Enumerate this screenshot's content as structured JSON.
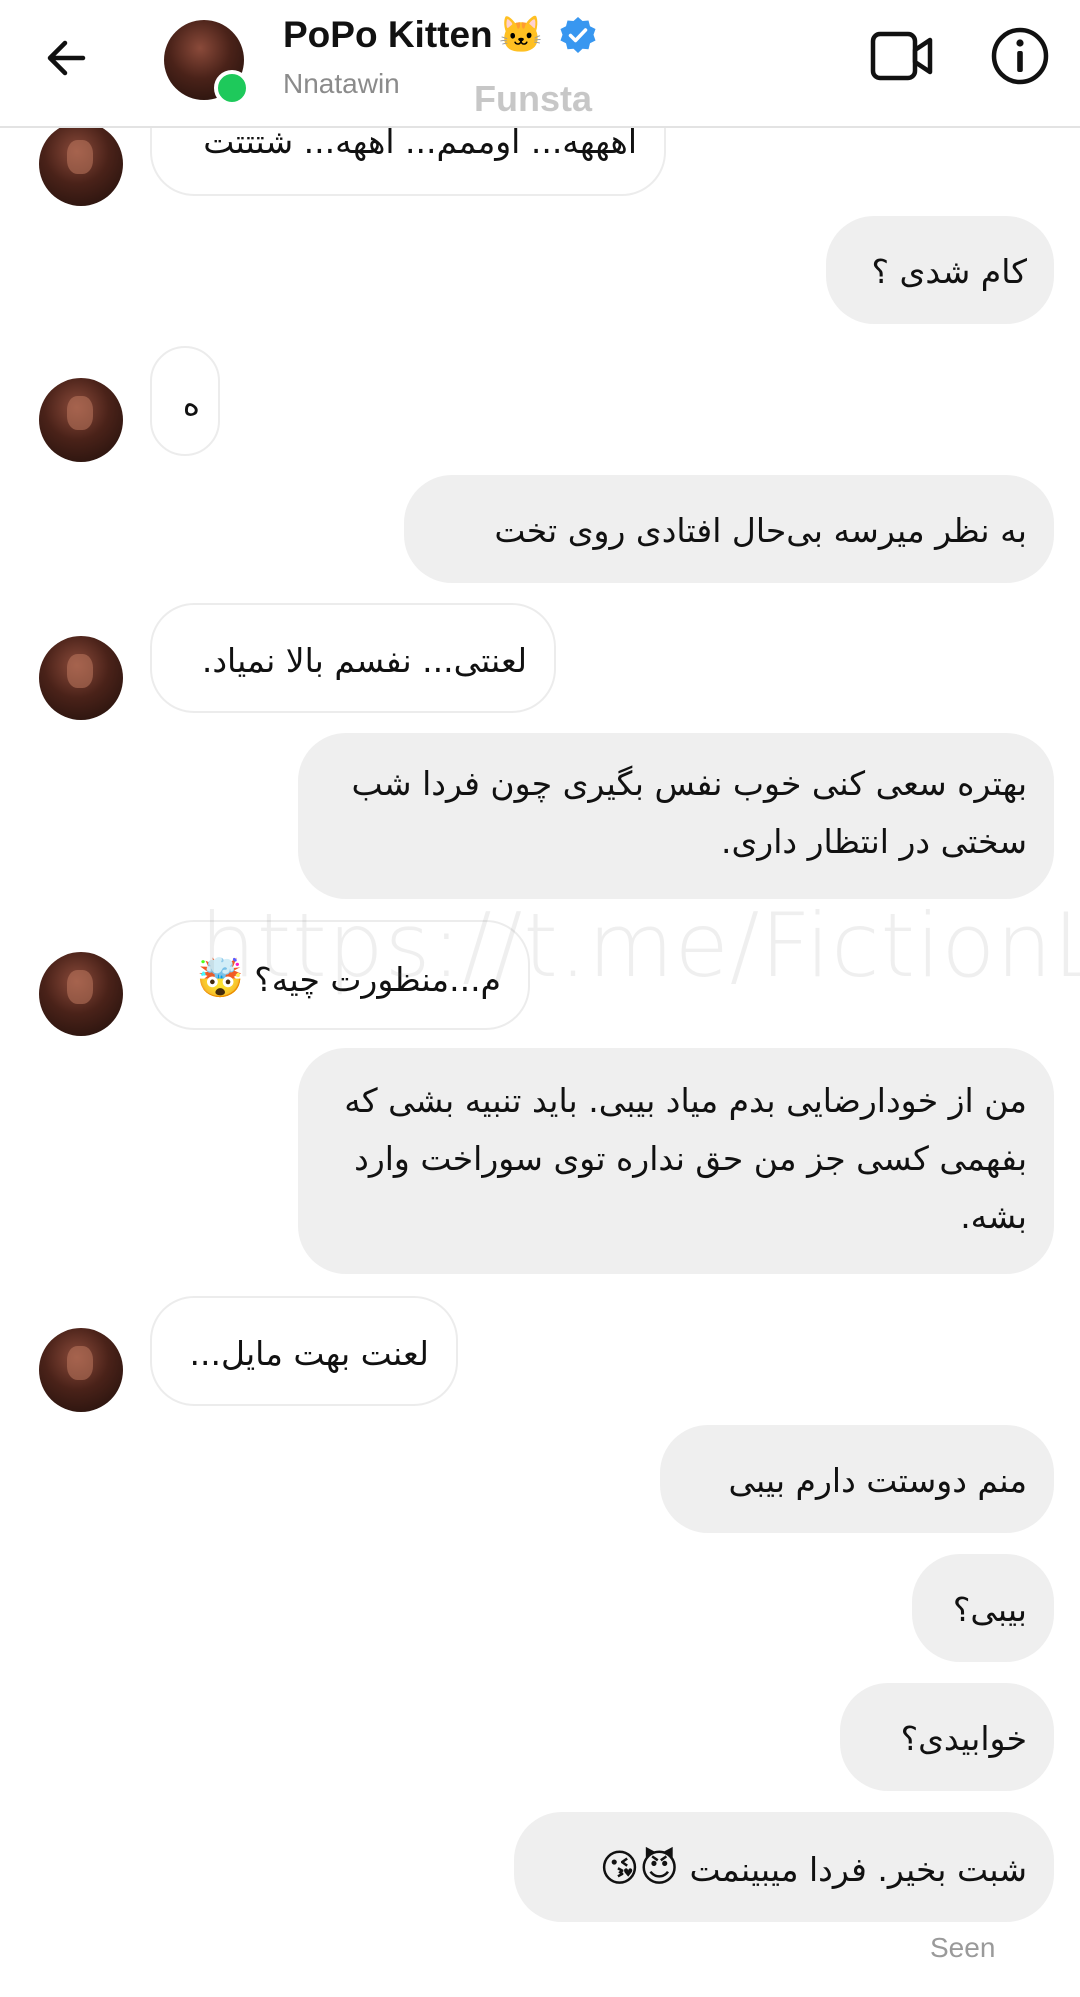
{
  "header": {
    "name": "PoPo Kitten",
    "name_emoji": "🐱",
    "username": "Nnatawin",
    "tag": "Funsta",
    "icons": {
      "back": "arrow-left-icon",
      "verified": "verified-badge-icon",
      "video": "video-call-icon",
      "info": "info-icon"
    },
    "online_color": "#1ec95b",
    "verified_color": "#3897f0"
  },
  "messages": [
    {
      "from": "them",
      "text": "اهههه... اوممم... اههه... شتتتت"
    },
    {
      "from": "me",
      "text": "کام شدی ؟"
    },
    {
      "from": "them",
      "text": "ه"
    },
    {
      "from": "me",
      "text": "به نظر میرسه بی‌حال افتادی روی تخت"
    },
    {
      "from": "them",
      "text": "لعنتی... نفسم بالا نمیاد."
    },
    {
      "from": "me",
      "text": "بهتره سعی کنی خوب نفس بگیری چون فردا شب سختی در انتظار داری."
    },
    {
      "from": "them",
      "text": "م...منظورت چیه؟",
      "emoji": "🤯"
    },
    {
      "from": "me",
      "text": "من از خودارضایی بدم میاد بیبی. باید تنبیه بشی که بفهمی کسی جز من حق نداره توی سوراخت وارد بشه."
    },
    {
      "from": "them",
      "text": "لعنت بهت مایل..."
    },
    {
      "from": "me",
      "text": "منم دوستت دارم بیبی"
    },
    {
      "from": "me",
      "text": "بیبی؟"
    },
    {
      "from": "me",
      "text": "خوابیدی؟"
    },
    {
      "from": "me",
      "text": "شبت بخیر. فردا میبینمت",
      "emoji": "😈😘"
    }
  ],
  "watermark": "https://t.me/FictionLand_farsi",
  "status": {
    "seen": "Seen"
  }
}
